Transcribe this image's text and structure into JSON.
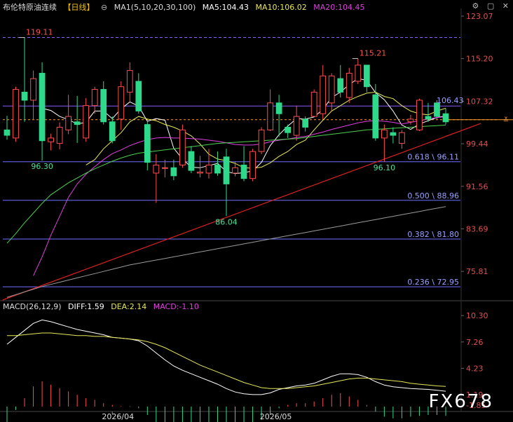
{
  "title": "布伦特原油连续",
  "period": "【日线】",
  "ma_header": {
    "ma1_label": "MA1(5,10,20,30,100)",
    "ma5": "MA5:104.43",
    "ma10": "MA10:106.02",
    "ma20": "MA20:104.45"
  },
  "macd_header": {
    "label": "MACD(26,12,9)",
    "diff": "DIFF:1.59",
    "dea": "DEA:2.14",
    "macd": "MACD:-1.10"
  },
  "watermark": "FX678",
  "colors": {
    "up": "#ff4d4d",
    "down": "#2fd98b",
    "ma5": "#ffffff",
    "ma10": "#e8e85a",
    "ma20": "#e040e0",
    "ma30": "#4ecf4e",
    "ma100": "#9a9a9a",
    "trend": "#e02020",
    "fib": "#6f6fff",
    "current": "#ff9d2f"
  },
  "chart_data": [
    {
      "type": "candlestick",
      "title": "布伦特原油连续",
      "ylim": [
        70.5,
        124.5
      ],
      "y_ticks": [
        123.07,
        115.2,
        107.32,
        99.44,
        91.56,
        83.69,
        75.81
      ],
      "x_labels": [
        {
          "index": 12,
          "label": "2026/04"
        },
        {
          "index": 30,
          "label": "2026/05"
        }
      ],
      "candles": [
        {
          "o": 102.0,
          "h": 104.6,
          "l": 100.2,
          "c": 101.0
        },
        {
          "o": 100.5,
          "h": 110.0,
          "l": 99.8,
          "c": 109.5
        },
        {
          "o": 109.0,
          "h": 119.11,
          "l": 103.5,
          "c": 107.5
        },
        {
          "o": 107.5,
          "h": 113.0,
          "l": 104.0,
          "c": 111.5
        },
        {
          "o": 112.5,
          "h": 114.5,
          "l": 96.3,
          "c": 100.0
        },
        {
          "o": 99.8,
          "h": 101.3,
          "l": 98.2,
          "c": 100.5
        },
        {
          "o": 99.5,
          "h": 103.4,
          "l": 98.4,
          "c": 102.5
        },
        {
          "o": 102.0,
          "h": 108.5,
          "l": 101.2,
          "c": 104.5
        },
        {
          "o": 103.5,
          "h": 108.3,
          "l": 99.6,
          "c": 103.0
        },
        {
          "o": 100.5,
          "h": 107.9,
          "l": 99.8,
          "c": 106.5
        },
        {
          "o": 106.5,
          "h": 110.0,
          "l": 105.0,
          "c": 109.5
        },
        {
          "o": 109.5,
          "h": 111.0,
          "l": 103.0,
          "c": 103.5
        },
        {
          "o": 103.5,
          "h": 104.5,
          "l": 99.5,
          "c": 100.0
        },
        {
          "o": 104.0,
          "h": 111.0,
          "l": 102.0,
          "c": 110.0
        },
        {
          "o": 109.0,
          "h": 114.5,
          "l": 107.0,
          "c": 113.0
        },
        {
          "o": 111.0,
          "h": 112.5,
          "l": 105.0,
          "c": 105.5
        },
        {
          "o": 103.0,
          "h": 103.5,
          "l": 94.5,
          "c": 96.0
        },
        {
          "o": 94.0,
          "h": 97.5,
          "l": 88.5,
          "c": 95.5
        },
        {
          "o": 95.0,
          "h": 96.5,
          "l": 93.2,
          "c": 95.0
        },
        {
          "o": 95.0,
          "h": 96.5,
          "l": 92.7,
          "c": 93.5
        },
        {
          "o": 95.5,
          "h": 103.0,
          "l": 95.0,
          "c": 102.0
        },
        {
          "o": 98.0,
          "h": 99.0,
          "l": 94.0,
          "c": 94.5
        },
        {
          "o": 94.0,
          "h": 97.2,
          "l": 93.2,
          "c": 94.2
        },
        {
          "o": 94.0,
          "h": 98.5,
          "l": 93.0,
          "c": 95.5
        },
        {
          "o": 95.5,
          "h": 98.0,
          "l": 93.5,
          "c": 94.0
        },
        {
          "o": 97.0,
          "h": 98.5,
          "l": 86.04,
          "c": 92.0
        },
        {
          "o": 94.0,
          "h": 96.2,
          "l": 93.4,
          "c": 95.0
        },
        {
          "o": 95.5,
          "h": 99.0,
          "l": 92.5,
          "c": 93.0
        },
        {
          "o": 93.0,
          "h": 98.5,
          "l": 92.5,
          "c": 98.0
        },
        {
          "o": 98.0,
          "h": 102.5,
          "l": 97.5,
          "c": 102.0
        },
        {
          "o": 102.0,
          "h": 109.5,
          "l": 101.8,
          "c": 107.0
        },
        {
          "o": 107.0,
          "h": 108.5,
          "l": 100.8,
          "c": 105.0
        },
        {
          "o": 102.5,
          "h": 103.0,
          "l": 100.5,
          "c": 101.5
        },
        {
          "o": 101.0,
          "h": 106.5,
          "l": 100.0,
          "c": 104.5
        },
        {
          "o": 104.0,
          "h": 104.5,
          "l": 101.7,
          "c": 102.5
        },
        {
          "o": 104.5,
          "h": 109.5,
          "l": 104.5,
          "c": 109.0
        },
        {
          "o": 105.0,
          "h": 114.0,
          "l": 104.0,
          "c": 112.0
        },
        {
          "o": 107.0,
          "h": 112.5,
          "l": 105.5,
          "c": 112.0
        },
        {
          "o": 111.5,
          "h": 114.0,
          "l": 108.0,
          "c": 109.0
        },
        {
          "o": 108.0,
          "h": 113.5,
          "l": 107.0,
          "c": 112.5
        },
        {
          "o": 111.0,
          "h": 115.21,
          "l": 110.5,
          "c": 114.0
        },
        {
          "o": 114.0,
          "h": 114.0,
          "l": 109.0,
          "c": 110.0
        },
        {
          "o": 108.5,
          "h": 110.5,
          "l": 100.0,
          "c": 100.5
        },
        {
          "o": 100.5,
          "h": 103.0,
          "l": 96.1,
          "c": 102.0
        },
        {
          "o": 101.5,
          "h": 102.5,
          "l": 99.5,
          "c": 101.0
        },
        {
          "o": 99.5,
          "h": 102.0,
          "l": 98.5,
          "c": 101.5
        },
        {
          "o": 103.5,
          "h": 104.8,
          "l": 103.0,
          "c": 104.0
        },
        {
          "o": 102.0,
          "h": 107.8,
          "l": 101.8,
          "c": 107.5
        },
        {
          "o": 104.5,
          "h": 107.0,
          "l": 103.5,
          "c": 104.0
        },
        {
          "o": 107.0,
          "h": 107.5,
          "l": 104.0,
          "c": 104.5
        },
        {
          "o": 105.0,
          "h": 106.0,
          "l": 103.0,
          "c": 103.5
        }
      ],
      "moving_averages": [
        {
          "name": "MA5",
          "values": [
            null,
            null,
            null,
            null,
            106.0,
            105.6,
            104.5,
            103.9,
            103.1,
            103.4,
            105.5,
            105.5,
            104.1,
            105.9,
            107.2,
            106.4,
            103.6,
            104.1,
            103.8,
            98.6,
            96.6,
            95.1,
            95.0,
            95.4,
            95.8,
            94.3,
            93.9,
            94.1,
            94.4,
            96.0,
            99.1,
            101.1,
            102.7,
            104.1,
            104.0,
            104.4,
            105.8,
            108.0,
            109.0,
            110.4,
            111.5,
            111.2,
            108.9,
            107.6,
            105.5,
            102.9,
            102.1,
            103.1,
            103.7,
            104.3,
            104.6
          ]
        },
        {
          "name": "MA10",
          "values": [
            null,
            null,
            null,
            null,
            null,
            null,
            null,
            null,
            null,
            95.5,
            96.5,
            98.5,
            100.0,
            101.5,
            103.5,
            104.5,
            104.0,
            103.7,
            103.0,
            102.5,
            101.8,
            100.9,
            99.4,
            97.5,
            96.6,
            96.3,
            95.8,
            95.0,
            94.9,
            95.1,
            95.9,
            97.1,
            98.0,
            99.3,
            100.1,
            102.0,
            103.8,
            105.5,
            106.5,
            107.5,
            108.2,
            108.8,
            109.0,
            108.2,
            107.8,
            106.5,
            105.5,
            105.0,
            104.8,
            105.5,
            106.02
          ]
        },
        {
          "name": "MA20",
          "values": [
            null,
            null,
            null,
            75.0,
            78.5,
            82.5,
            86.0,
            89.5,
            92.0,
            93.8,
            95.2,
            96.5,
            97.6,
            98.3,
            99.1,
            99.7,
            100.2,
            100.5,
            100.6,
            100.5,
            100.5,
            100.4,
            100.3,
            100.1,
            99.9,
            99.6,
            99.3,
            99.2,
            99.2,
            99.4,
            99.8,
            100.1,
            100.3,
            100.6,
            100.8,
            101.2,
            101.6,
            102.1,
            102.5,
            102.9,
            103.3,
            103.6,
            103.7,
            103.6,
            103.4,
            103.1,
            103.4,
            103.7,
            104.0,
            104.3,
            104.45
          ]
        },
        {
          "name": "MA30",
          "values": [
            81.0,
            82.8,
            84.8,
            86.6,
            88.4,
            90.0,
            91.1,
            92.2,
            93.1,
            94.0,
            94.8,
            95.5,
            96.2,
            96.8,
            97.3,
            97.7,
            97.9,
            98.1,
            98.3,
            98.5,
            98.7,
            98.9,
            99.1,
            99.3,
            99.5,
            99.6,
            99.7,
            99.8,
            99.9,
            100.0,
            100.1,
            100.2,
            100.3,
            100.4,
            100.6,
            100.8,
            101.0,
            101.2,
            101.4,
            101.6,
            101.8,
            102.0,
            102.1,
            102.2,
            102.3,
            102.4,
            102.5,
            102.6,
            102.7,
            102.8,
            102.9
          ]
        },
        {
          "name": "MA100",
          "values": [
            71.0,
            71.5,
            72.0,
            72.5,
            73.0,
            73.4,
            73.8,
            74.2,
            74.6,
            75.0,
            75.4,
            75.8,
            76.2,
            76.6,
            77.0,
            77.3,
            77.6,
            77.9,
            78.2,
            78.5,
            78.8,
            79.1,
            79.4,
            79.7,
            80.0,
            80.3,
            80.6,
            80.9,
            81.2,
            81.5,
            81.8,
            82.1,
            82.4,
            82.7,
            83.0,
            83.3,
            83.6,
            83.9,
            84.2,
            84.5,
            84.8,
            85.1,
            85.4,
            85.7,
            86.0,
            86.3,
            86.6,
            86.9,
            87.2,
            87.5,
            87.8
          ]
        }
      ],
      "fib_levels": [
        {
          "label": "0.618 \\ 96.11",
          "value": 96.11
        },
        {
          "label": "0.500 \\ 88.96",
          "value": 88.96
        },
        {
          "label": "0.382 \\ 81.80",
          "value": 81.8
        },
        {
          "label": "0.236 \\ 72.95",
          "value": 72.95
        }
      ],
      "horizontal_lines": [
        {
          "label": "119.11",
          "value": 119.11,
          "style": "dashed"
        },
        {
          "label": "106.43",
          "value": 106.43,
          "style": "solid"
        }
      ],
      "current_price": 103.9,
      "trendline": {
        "from": {
          "index": -0.5,
          "value": 70.5
        },
        "to": {
          "index": 54.0,
          "value": 103.2
        }
      },
      "annotations": [
        {
          "label": "119.11",
          "index": 2,
          "value": 119.11,
          "kind": "high"
        },
        {
          "label": "96.30",
          "index": 4,
          "value": 96.3,
          "kind": "low"
        },
        {
          "label": "86.04",
          "index": 25,
          "value": 86.04,
          "kind": "low"
        },
        {
          "label": "115.21",
          "index": 40,
          "value": 115.21,
          "kind": "high"
        },
        {
          "label": "96.10",
          "index": 43,
          "value": 96.1,
          "kind": "low"
        },
        {
          "label": "106.43",
          "index": 48,
          "value": 106.43,
          "kind": "level"
        }
      ]
    },
    {
      "type": "macd",
      "title": "MACD(26,12,9)",
      "ylim": [
        -0.5,
        10.8
      ],
      "y_ticks": [
        10.3,
        7.26,
        4.23,
        1.19
      ],
      "y_ticks_partial": [
        "-1.85"
      ],
      "diff": [
        7.0,
        7.8,
        8.6,
        9.4,
        9.8,
        9.6,
        9.3,
        9.0,
        8.7,
        8.5,
        8.3,
        8.1,
        7.8,
        7.7,
        7.6,
        7.4,
        6.8,
        6.0,
        5.2,
        4.5,
        4.0,
        3.6,
        3.2,
        2.8,
        2.4,
        1.9,
        1.5,
        1.3,
        1.2,
        1.2,
        1.4,
        1.8,
        2.0,
        2.2,
        2.3,
        2.5,
        2.9,
        3.3,
        3.6,
        3.6,
        3.5,
        3.2,
        2.7,
        2.3,
        2.1,
        2.0,
        1.9,
        1.85,
        1.8,
        1.7,
        1.59
      ],
      "dea": [
        8.0,
        8.0,
        8.1,
        8.2,
        8.3,
        8.3,
        8.2,
        8.1,
        8.0,
        8.0,
        7.9,
        7.9,
        7.8,
        7.7,
        7.6,
        7.5,
        7.3,
        7.0,
        6.6,
        6.1,
        5.6,
        5.1,
        4.6,
        4.2,
        3.8,
        3.4,
        3.0,
        2.6,
        2.3,
        2.0,
        1.9,
        1.9,
        1.9,
        2.0,
        2.1,
        2.2,
        2.4,
        2.6,
        2.8,
        3.0,
        3.1,
        3.1,
        3.0,
        2.9,
        2.8,
        2.7,
        2.5,
        2.4,
        2.3,
        2.2,
        2.14
      ],
      "hist": [
        -2.0,
        -0.4,
        1.0,
        2.4,
        3.0,
        2.6,
        2.2,
        1.8,
        1.4,
        1.0,
        0.8,
        0.4,
        0.2,
        0.05,
        0.05,
        -0.2,
        -1.0,
        -2.0,
        -2.8,
        -3.2,
        -3.2,
        -3.0,
        -2.8,
        -2.8,
        -2.8,
        -3.0,
        -3.0,
        -2.6,
        -2.2,
        -1.6,
        -1.0,
        -0.2,
        0.2,
        0.4,
        0.4,
        0.6,
        1.0,
        1.4,
        1.6,
        1.2,
        0.8,
        0.2,
        -0.6,
        -1.2,
        -1.4,
        -1.4,
        -1.2,
        -1.1,
        -1.0,
        -1.0,
        -1.1
      ]
    }
  ]
}
